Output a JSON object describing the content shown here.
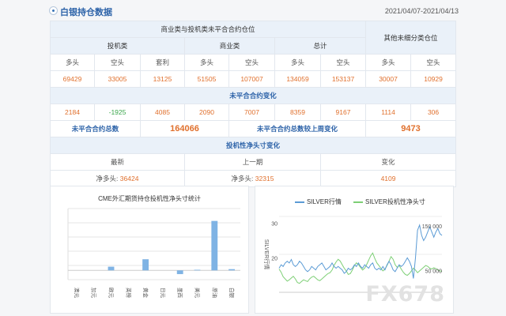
{
  "header": {
    "title": "白银持仓数据",
    "date_range": "2021/04/07-2021/04/13"
  },
  "table": {
    "top_group": "商业类与投机类未平合合约仓位",
    "other_group": "其他未细分类仓位",
    "sub_groups": [
      "投机类",
      "商业类",
      "总计"
    ],
    "columns": [
      "多头",
      "空头",
      "套利",
      "多头",
      "空头",
      "多头",
      "空头",
      "多头",
      "空头"
    ],
    "values": [
      "69429",
      "33005",
      "13125",
      "51505",
      "107007",
      "134059",
      "153137",
      "30007",
      "10929"
    ],
    "change_title": "未平合合约变化",
    "changes": [
      "2184",
      "-1925",
      "4085",
      "2090",
      "7007",
      "8359",
      "9167",
      "1114",
      "306"
    ],
    "total_label": "未平合合约总数",
    "total_value": "164066",
    "weekly_label": "未平合合约总数较上周变化",
    "weekly_value": "9473",
    "spec_title": "投机性净头寸变化",
    "spec_cols": [
      "最新",
      "上一期",
      "变化"
    ],
    "latest_label": "净多头:",
    "latest_value": "36424",
    "prev_label": "净多头:",
    "prev_value": "32315",
    "change_value": "4109"
  },
  "chart_data": [
    {
      "type": "bar",
      "title": "CME外汇期货持仓投机性净头寸统计",
      "categories": [
        "澳元",
        "加元",
        "欧元",
        "英镑",
        "黄金",
        "日元",
        "墨西",
        "美元",
        "原油",
        "白银"
      ],
      "values": [
        0,
        0,
        6,
        0,
        18,
        0,
        -6,
        1,
        80,
        2
      ],
      "ylim": [
        -15,
        100
      ],
      "grid": true,
      "bar_color": "#7fb3e4"
    },
    {
      "type": "line",
      "series": [
        {
          "name": "SILVER行情",
          "color": "#5b9bd5"
        },
        {
          "name": "SILVER投机性净头寸",
          "color": "#7dcf75"
        }
      ],
      "ylabel": "SILVER行情",
      "left_ticks": [
        "30",
        "20"
      ],
      "right_ticks": [
        "150 000",
        "50 000"
      ],
      "silver_price": [
        17,
        18,
        17.5,
        18.5,
        19,
        18.5,
        19.5,
        18,
        17.5,
        18,
        19,
        18.5,
        17.5,
        16.5,
        16,
        16.5,
        17.5,
        17,
        16.5,
        17.5,
        18,
        18.5,
        17.5,
        16.5,
        17,
        17.5,
        18.5,
        17.5,
        17,
        17.5,
        17,
        16.5,
        15.5,
        16,
        17,
        16.5,
        17,
        18,
        17.5,
        18.5,
        17.5,
        17,
        18,
        17.5,
        17,
        18,
        18.5,
        17,
        16.5,
        17,
        16.5,
        17.5,
        16.5,
        18,
        19,
        18,
        16.5,
        16,
        17,
        18,
        17.5,
        18,
        19,
        20,
        19,
        17.5,
        14,
        20,
        28,
        29.5,
        26.5,
        25,
        26,
        27.5,
        29,
        27.5,
        26,
        27.5,
        28.5,
        27,
        26.5
      ],
      "silver_net": [
        62000,
        55000,
        45000,
        40000,
        35000,
        38000,
        42000,
        46000,
        40000,
        32000,
        30000,
        34000,
        38000,
        36000,
        34000,
        40000,
        44000,
        46000,
        42000,
        38000,
        36000,
        40000,
        44000,
        48000,
        52000,
        54000,
        60000,
        70000,
        78000,
        84000,
        80000,
        72000,
        64000,
        58000,
        50000,
        52000,
        60000,
        70000,
        76000,
        72000,
        66000,
        60000,
        64000,
        72000,
        82000,
        92000,
        98000,
        86000,
        76000,
        70000,
        64000,
        58000,
        62000,
        70000,
        80000,
        90000,
        84000,
        72000,
        66000,
        70000,
        62000,
        55000,
        50000,
        48000,
        52000,
        58000,
        64000,
        60000,
        54000,
        58000,
        62000,
        66000,
        70000,
        68000,
        64000,
        62000,
        65000,
        63000,
        60000,
        58000,
        57000
      ],
      "legend_position": "top",
      "grid": true
    }
  ],
  "watermark": "FX678"
}
